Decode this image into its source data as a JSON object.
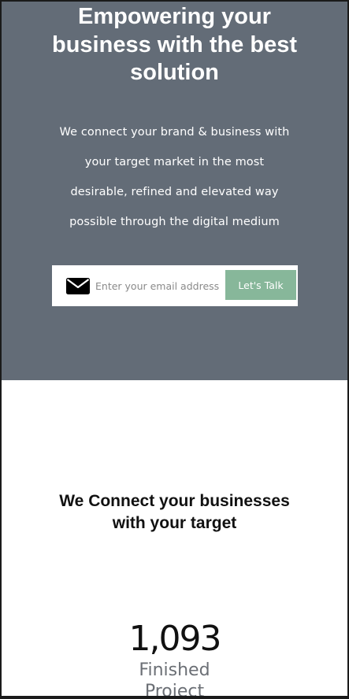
{
  "hero": {
    "title_lines": [
      "Empowering your",
      "business with the best",
      "solution"
    ],
    "subtitle_lines": [
      "We connect your brand & business with",
      "your target market in the most",
      "desirable, refined and elevated way",
      "possible through the digital medium"
    ],
    "background_color": "#636c77"
  },
  "signup": {
    "icon": "envelope-icon",
    "email_placeholder": "Enter your email address",
    "button_label": "Let's Talk",
    "button_color": "#87b79a"
  },
  "section": {
    "title_lines": [
      "We Connect your businesses",
      "with your target"
    ]
  },
  "stats": {
    "items": [
      {
        "value": "1,093",
        "label_lines": [
          "Finished",
          "Project"
        ]
      }
    ]
  }
}
